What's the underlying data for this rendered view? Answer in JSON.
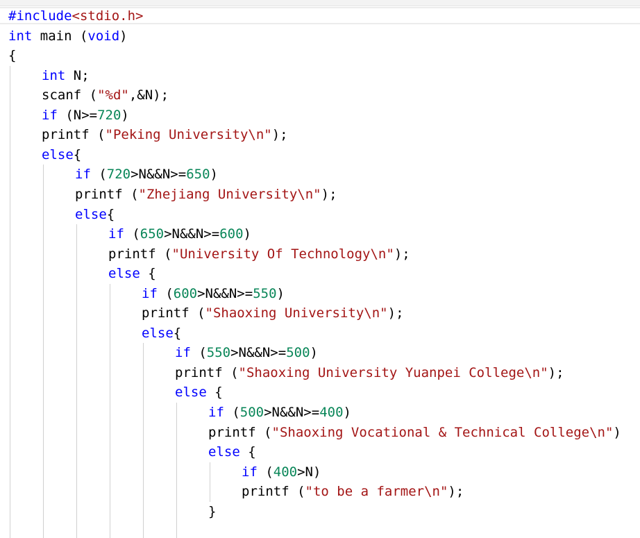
{
  "editor": {
    "lines": [
      {
        "indent": 0,
        "tokens": [
          {
            "t": "pp",
            "v": "#include"
          },
          {
            "t": "hdr",
            "v": "<stdio.h>"
          }
        ]
      },
      {
        "indent": 0,
        "tokens": [
          {
            "t": "kw",
            "v": "int"
          },
          {
            "t": "p",
            "v": " main ("
          },
          {
            "t": "kw",
            "v": "void"
          },
          {
            "t": "p",
            "v": ")"
          }
        ]
      },
      {
        "indent": 0,
        "tokens": [
          {
            "t": "p",
            "v": "{"
          }
        ]
      },
      {
        "indent": 1,
        "tokens": [
          {
            "t": "kw",
            "v": "int"
          },
          {
            "t": "p",
            "v": " N;"
          }
        ]
      },
      {
        "indent": 1,
        "tokens": [
          {
            "t": "p",
            "v": "scanf ("
          },
          {
            "t": "str",
            "v": "\"%d\""
          },
          {
            "t": "p",
            "v": ",&N);"
          }
        ]
      },
      {
        "indent": 1,
        "tokens": [
          {
            "t": "kw",
            "v": "if"
          },
          {
            "t": "p",
            "v": " (N>="
          },
          {
            "t": "num",
            "v": "720"
          },
          {
            "t": "p",
            "v": ")"
          }
        ]
      },
      {
        "indent": 1,
        "tokens": [
          {
            "t": "p",
            "v": "printf ("
          },
          {
            "t": "str",
            "v": "\"Peking University\\n\""
          },
          {
            "t": "p",
            "v": ");"
          }
        ]
      },
      {
        "indent": 1,
        "tokens": [
          {
            "t": "kw",
            "v": "else"
          },
          {
            "t": "p",
            "v": "{"
          }
        ]
      },
      {
        "indent": 2,
        "tokens": [
          {
            "t": "kw",
            "v": "if"
          },
          {
            "t": "p",
            "v": " ("
          },
          {
            "t": "num",
            "v": "720"
          },
          {
            "t": "p",
            "v": ">N&&N>="
          },
          {
            "t": "num",
            "v": "650"
          },
          {
            "t": "p",
            "v": ")"
          }
        ]
      },
      {
        "indent": 2,
        "tokens": [
          {
            "t": "p",
            "v": "printf ("
          },
          {
            "t": "str",
            "v": "\"Zhejiang University\\n\""
          },
          {
            "t": "p",
            "v": ");"
          }
        ]
      },
      {
        "indent": 2,
        "tokens": [
          {
            "t": "kw",
            "v": "else"
          },
          {
            "t": "p",
            "v": "{"
          }
        ]
      },
      {
        "indent": 3,
        "tokens": [
          {
            "t": "kw",
            "v": "if"
          },
          {
            "t": "p",
            "v": " ("
          },
          {
            "t": "num",
            "v": "650"
          },
          {
            "t": "p",
            "v": ">N&&N>="
          },
          {
            "t": "num",
            "v": "600"
          },
          {
            "t": "p",
            "v": ")"
          }
        ]
      },
      {
        "indent": 3,
        "tokens": [
          {
            "t": "p",
            "v": "printf ("
          },
          {
            "t": "str",
            "v": "\"University Of Technology\\n\""
          },
          {
            "t": "p",
            "v": ");"
          }
        ]
      },
      {
        "indent": 3,
        "tokens": [
          {
            "t": "kw",
            "v": "else"
          },
          {
            "t": "p",
            "v": " {"
          }
        ]
      },
      {
        "indent": 4,
        "tokens": [
          {
            "t": "kw",
            "v": "if"
          },
          {
            "t": "p",
            "v": " ("
          },
          {
            "t": "num",
            "v": "600"
          },
          {
            "t": "p",
            "v": ">N&&N>="
          },
          {
            "t": "num",
            "v": "550"
          },
          {
            "t": "p",
            "v": ")"
          }
        ]
      },
      {
        "indent": 4,
        "tokens": [
          {
            "t": "p",
            "v": "printf ("
          },
          {
            "t": "str",
            "v": "\"Shaoxing University\\n\""
          },
          {
            "t": "p",
            "v": ");"
          }
        ]
      },
      {
        "indent": 4,
        "tokens": [
          {
            "t": "kw",
            "v": "else"
          },
          {
            "t": "p",
            "v": "{"
          }
        ]
      },
      {
        "indent": 5,
        "tokens": [
          {
            "t": "kw",
            "v": "if"
          },
          {
            "t": "p",
            "v": " ("
          },
          {
            "t": "num",
            "v": "550"
          },
          {
            "t": "p",
            "v": ">N&&N>="
          },
          {
            "t": "num",
            "v": "500"
          },
          {
            "t": "p",
            "v": ")"
          }
        ]
      },
      {
        "indent": 5,
        "tokens": [
          {
            "t": "p",
            "v": "printf ("
          },
          {
            "t": "str",
            "v": "\"Shaoxing University Yuanpei College\\n\""
          },
          {
            "t": "p",
            "v": ");"
          }
        ]
      },
      {
        "indent": 5,
        "tokens": [
          {
            "t": "kw",
            "v": "else"
          },
          {
            "t": "p",
            "v": " {"
          }
        ]
      },
      {
        "indent": 6,
        "tokens": [
          {
            "t": "kw",
            "v": "if"
          },
          {
            "t": "p",
            "v": " ("
          },
          {
            "t": "num",
            "v": "500"
          },
          {
            "t": "p",
            "v": ">N&&N>="
          },
          {
            "t": "num",
            "v": "400"
          },
          {
            "t": "p",
            "v": ")"
          }
        ]
      },
      {
        "indent": 6,
        "tokens": [
          {
            "t": "p",
            "v": "printf ("
          },
          {
            "t": "str",
            "v": "\"Shaoxing Vocational & Technical College\\n\""
          },
          {
            "t": "p",
            "v": ")"
          }
        ]
      },
      {
        "indent": 6,
        "tokens": [
          {
            "t": "kw",
            "v": "else"
          },
          {
            "t": "p",
            "v": " {"
          }
        ]
      },
      {
        "indent": 7,
        "tokens": [
          {
            "t": "kw",
            "v": "if"
          },
          {
            "t": "p",
            "v": " ("
          },
          {
            "t": "num",
            "v": "400"
          },
          {
            "t": "p",
            "v": ">N)"
          }
        ]
      },
      {
        "indent": 7,
        "tokens": [
          {
            "t": "p",
            "v": "printf ("
          },
          {
            "t": "str",
            "v": "\"to be a farmer\\n\""
          },
          {
            "t": "p",
            "v": ");"
          }
        ]
      },
      {
        "indent": 6,
        "tokens": [
          {
            "t": "p",
            "v": "}"
          }
        ]
      }
    ]
  },
  "colors": {
    "keyword": "#0000ff",
    "string": "#a31515",
    "number": "#098658",
    "plain": "#000000",
    "background": "#ffffff"
  }
}
